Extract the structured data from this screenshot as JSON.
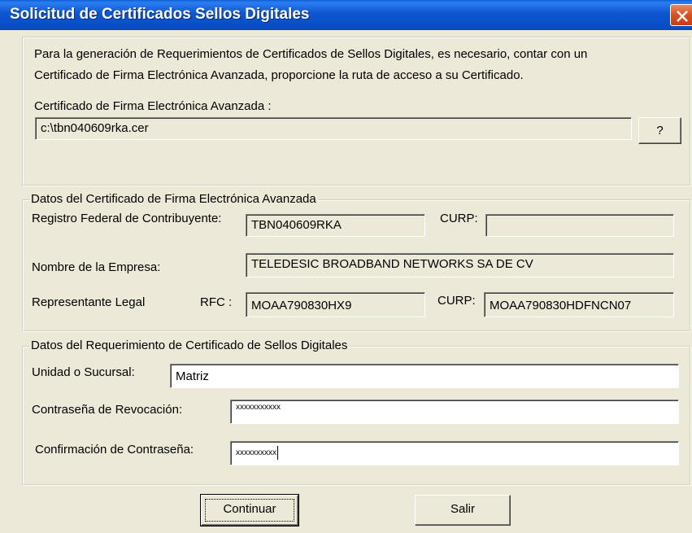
{
  "window": {
    "title": "Solicitud de Certificados Sellos Digitales"
  },
  "intro": {
    "line1": "Para la generación de Requerimientos de Certificados de Sellos Digitales, es necesario, contar con un",
    "line2": "Certificado de Firma Electrónica Avanzada, proporcione la ruta de acceso a su Certificado.",
    "cert_label": "Certificado de Firma Electrónica Avanzada :",
    "cert_path": "c:\\tbn040609rka.cer",
    "browse_label": "?"
  },
  "cert_data": {
    "legend": "Datos del Certificado de Firma Electrónica Avanzada",
    "rfc_label": "Registro Federal de Contribuyente:",
    "rfc_value": "TBN040609RKA",
    "curp_label": "CURP:",
    "curp_value": "",
    "company_label": "Nombre de la Empresa:",
    "company_value": "TELEDESIC BROADBAND NETWORKS SA DE CV",
    "rep_label": "Representante Legal",
    "rep_rfc_label": "RFC :",
    "rep_rfc_value": "MOAA790830HX9",
    "rep_curp_label": "CURP:",
    "rep_curp_value": "MOAA790830HDFNCN07"
  },
  "request": {
    "legend": "Datos del Requerimiento de Certificado de Sellos Digitales",
    "unit_label": "Unidad o Sucursal:",
    "unit_value": "Matriz",
    "revoke_label": "Contraseña de Revocación:",
    "revoke_value": "xxxxxxxxxxx",
    "confirm_label": "Confirmación de Contraseña:",
    "confirm_value": "xxxxxxxxxx"
  },
  "buttons": {
    "continue": "Continuar",
    "exit": "Salir"
  }
}
